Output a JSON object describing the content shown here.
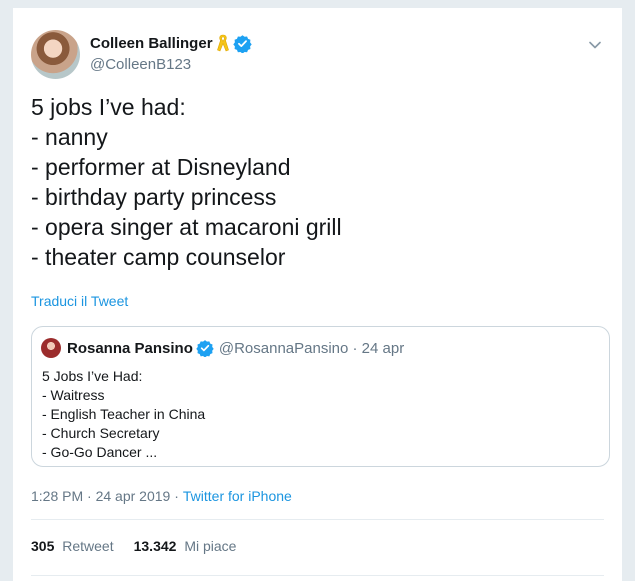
{
  "author": {
    "display_name": "Colleen Ballinger",
    "handle": "@ColleenB123"
  },
  "tweet": {
    "lines": [
      "5 jobs I’ve had:",
      "- nanny",
      "- performer at Disneyland",
      "- birthday party princess",
      "- opera singer at macaroni grill",
      "- theater camp counselor"
    ],
    "translate_label": "Traduci il Tweet"
  },
  "quoted": {
    "display_name": "Rosanna Pansino",
    "handle_date": "@RosannaPansino · 24 apr",
    "lines": [
      "5 Jobs I’ve Had:",
      "- Waitress",
      "- English Teacher in China",
      "- Church Secretary",
      "- Go-Go Dancer ..."
    ]
  },
  "meta": {
    "time_date": "1:28 PM · 24 apr 2019 ·",
    "source": "Twitter for iPhone"
  },
  "stats": {
    "retweets_count": "305",
    "retweets_label": "Retweet",
    "likes_count": "13.342",
    "likes_label": "Mi piace"
  },
  "colors": {
    "accent": "#1b95e0",
    "verified": "#1da1f2",
    "ribbon": "#f5c518",
    "muted": "#657786"
  },
  "icons": {
    "verified": "verified-badge-icon",
    "ribbon": "yellow-ribbon-icon",
    "menu": "chevron-down-icon"
  }
}
